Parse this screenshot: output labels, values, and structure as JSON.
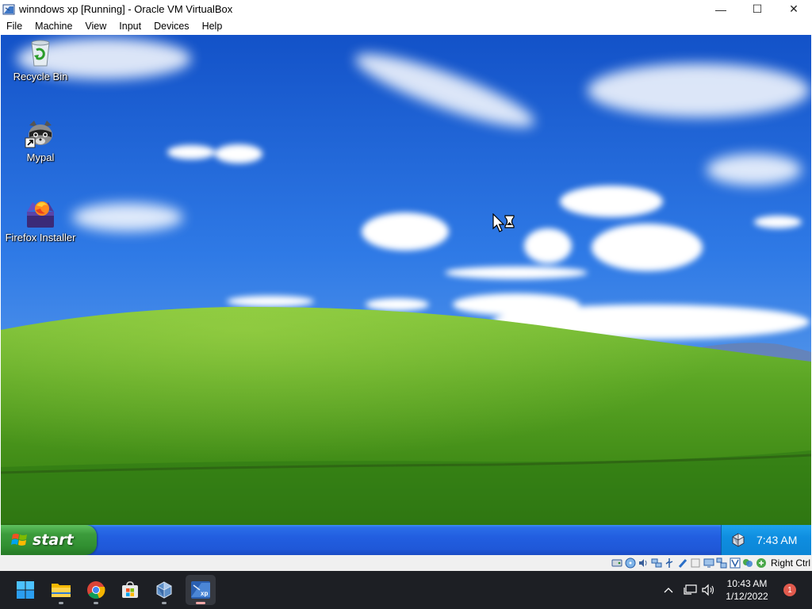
{
  "window": {
    "title": "winndows xp [Running] - Oracle VM VirtualBox",
    "controls": {
      "minimize": "—",
      "maximize": "☐",
      "close": "✕"
    }
  },
  "menubar": {
    "items": [
      "File",
      "Machine",
      "View",
      "Input",
      "Devices",
      "Help"
    ]
  },
  "guest": {
    "desktop_icons": [
      {
        "label": "Recycle Bin",
        "icon": "recycle-bin-icon"
      },
      {
        "label": "Mypal",
        "icon": "mypal-raccoon-icon"
      },
      {
        "label": "Firefox Installer",
        "icon": "firefox-installer-icon"
      }
    ],
    "cursor": "busy-cursor-icon",
    "taskbar": {
      "start_label": "start",
      "clock": "7:43 AM",
      "tray_icon": "virtualbox-guest-additions-icon"
    },
    "colors": {
      "taskbar_blue": "#225ee0",
      "start_green": "#318f31",
      "tray_blue": "#0f8ee0",
      "sky": "#1e62d6",
      "hill": "#4e9a1a"
    }
  },
  "vbox_status": {
    "icons": [
      "hard-disk-icon",
      "optical-disk-icon",
      "audio-icon",
      "network-icon",
      "usb-icon",
      "shared-folders-icon",
      "display-icon",
      "video-capture-icon",
      "recording-icon",
      "guest-additions-icon",
      "mouse-integration-icon",
      "keyboard-capture-icon"
    ],
    "host_key": "Right Ctrl"
  },
  "host_taskbar": {
    "apps": [
      "windows-start-icon",
      "file-explorer-icon",
      "chrome-icon",
      "microsoft-store-icon",
      "virtualbox-icon",
      "virtualbox-winxp-vm-icon"
    ],
    "time": "10:43 AM",
    "date": "1/12/2022",
    "notification_count": "1"
  }
}
